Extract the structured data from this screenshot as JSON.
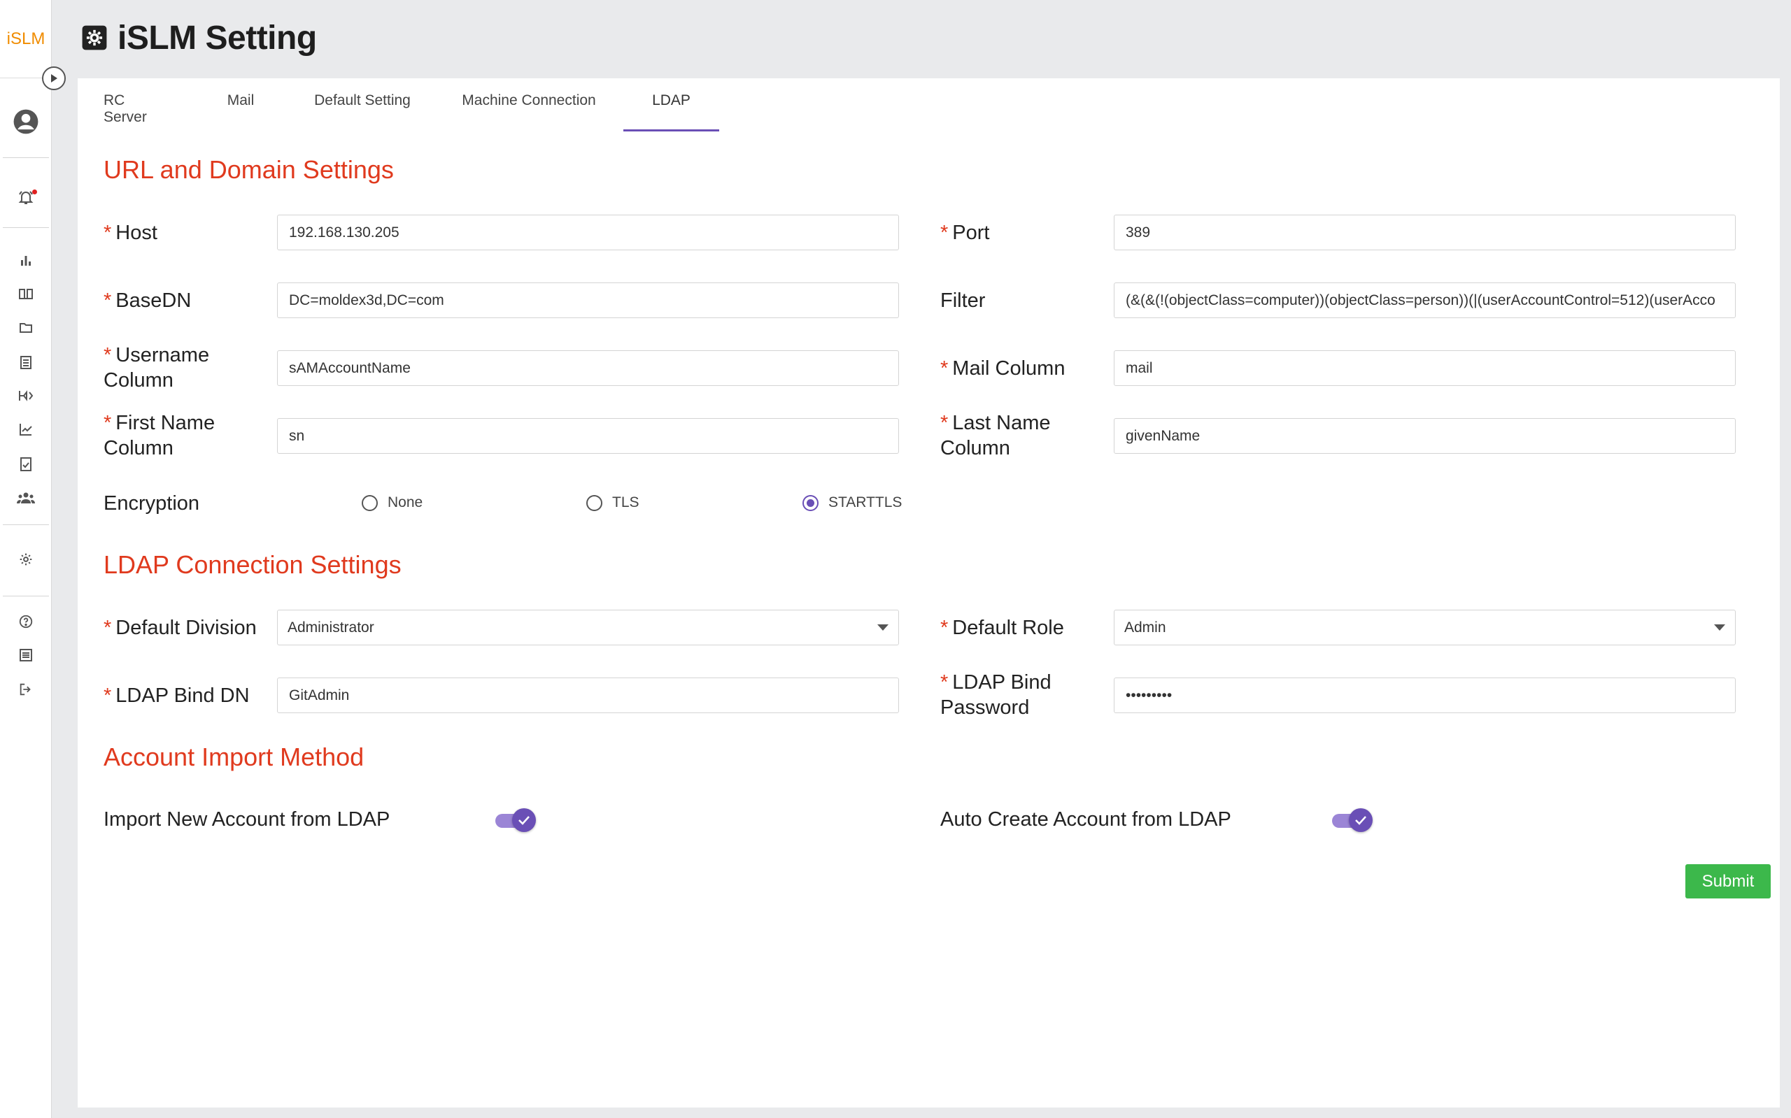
{
  "app": {
    "logo_text": "iSLM",
    "page_title": "iSLM Setting"
  },
  "tabs": [
    {
      "label": "RC Server"
    },
    {
      "label": "Mail"
    },
    {
      "label": "Default Setting"
    },
    {
      "label": "Machine Connection"
    },
    {
      "label": "LDAP",
      "active": true
    }
  ],
  "sections": {
    "url_domain": "URL and Domain Settings",
    "ldap_connection": "LDAP Connection Settings",
    "account_import": "Account Import Method"
  },
  "fields": {
    "host": {
      "label": "Host",
      "value": "192.168.130.205",
      "required": true
    },
    "port": {
      "label": "Port",
      "value": "389",
      "required": true
    },
    "base_dn": {
      "label": "BaseDN",
      "value": "DC=moldex3d,DC=com",
      "required": true
    },
    "filter": {
      "label": "Filter",
      "value": "(&(&(!(objectClass=computer))(objectClass=person))(|(userAccountControl=512)(userAcco",
      "required": false
    },
    "username_column": {
      "label_line1": "Username",
      "label_line2": "Column",
      "value": "sAMAccountName",
      "required": true
    },
    "mail_column": {
      "label": "Mail Column",
      "value": "mail",
      "required": true
    },
    "first_name_column": {
      "label_line1": "First Name",
      "label_line2": "Column",
      "value": "sn",
      "required": true
    },
    "last_name_column": {
      "label_line1": "Last Name",
      "label_line2": "Column",
      "value": "givenName",
      "required": true
    },
    "encryption": {
      "label": "Encryption",
      "options": [
        "None",
        "TLS",
        "STARTTLS"
      ],
      "selected": "STARTTLS"
    },
    "default_division": {
      "label": "Default Division",
      "value": "Administrator",
      "required": true
    },
    "default_role": {
      "label": "Default Role",
      "value": "Admin",
      "required": true
    },
    "ldap_bind_dn": {
      "label": "LDAP Bind DN",
      "value": "GitAdmin",
      "required": true
    },
    "ldap_bind_password": {
      "label_line1": "LDAP Bind",
      "label_line2": "Password",
      "value": "•••••••••",
      "required": true
    },
    "import_new_account": {
      "label": "Import New Account from LDAP",
      "enabled": true
    },
    "auto_create_account": {
      "label": "Auto Create Account from LDAP",
      "enabled": true
    }
  },
  "required_marker": "*",
  "actions": {
    "submit_label": "Submit"
  },
  "colors": {
    "accent": "#6a4fb6",
    "section_title": "#e03a1e",
    "submit": "#3cb84b",
    "logo": "#f08c00"
  },
  "sidebar_icons": [
    "user-icon",
    "bell-icon",
    "bar-chart-icon",
    "book-icon",
    "folder-icon",
    "clipboard-icon",
    "machine-icon",
    "line-chart-icon",
    "checklist-icon",
    "team-icon",
    "gear-icon",
    "help-icon",
    "list-icon",
    "logout-icon"
  ]
}
